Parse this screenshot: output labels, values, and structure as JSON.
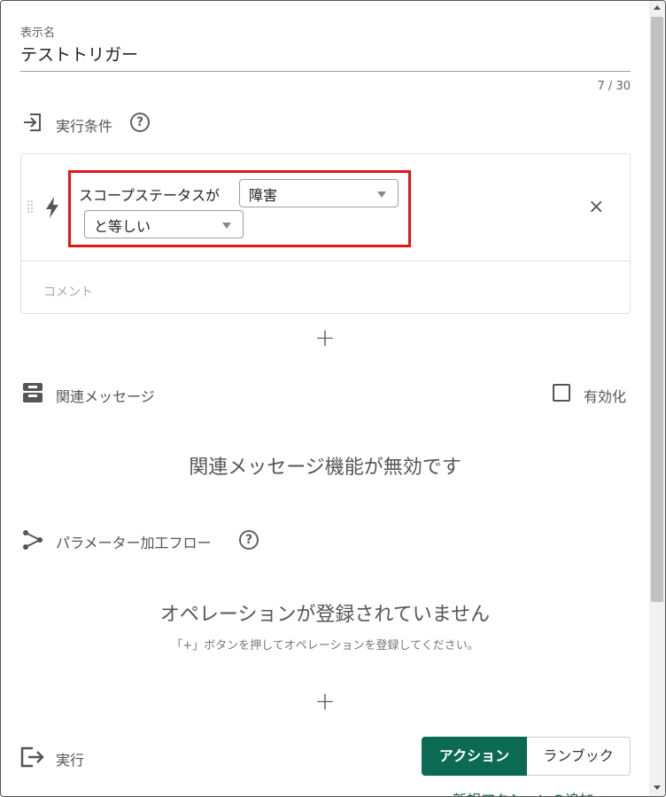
{
  "display_name": {
    "label": "表示名",
    "value": "テストトリガー",
    "counter": "7 / 30"
  },
  "conditions": {
    "title": "実行条件",
    "help_glyph": "?",
    "icon": "login-icon",
    "rule": {
      "prefix": "スコープステータスが",
      "status_select": "障害",
      "operator_select": "と等しい"
    },
    "close_glyph": "×",
    "comment_placeholder": "コメント",
    "add_glyph": "+"
  },
  "related_messages": {
    "title": "関連メッセージ",
    "icon": "inbox-icon",
    "enable_label": "有効化",
    "enabled": false,
    "disabled_text": "関連メッセージ機能が無効です"
  },
  "parameter_flow": {
    "title": "パラメーター加工フロー",
    "help_glyph": "?",
    "icon": "flow-icon",
    "empty_title": "オペレーションが登録されていません",
    "empty_hint": "「+」ボタンを押してオペレーションを登録してください。",
    "add_glyph": "+"
  },
  "execution": {
    "title": "実行",
    "icon": "logout-icon",
    "tabs": [
      {
        "label": "アクション",
        "active": true
      },
      {
        "label": "ランブック",
        "active": false
      }
    ],
    "add_action_link": "新規アクションの追加"
  },
  "colors": {
    "accent": "#0b6b52",
    "highlight": "#e0161e"
  }
}
